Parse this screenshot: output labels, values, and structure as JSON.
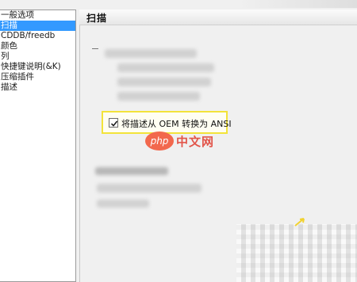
{
  "sidebar": {
    "items": [
      {
        "label": "一般选项",
        "selected": false
      },
      {
        "label": "扫描",
        "selected": true
      },
      {
        "label": "CDDB/freedb",
        "selected": false
      },
      {
        "label": "颜色",
        "selected": false
      },
      {
        "label": "列",
        "selected": false
      },
      {
        "label": "快捷键说明(&K)",
        "selected": false
      },
      {
        "label": "压缩插件",
        "selected": false
      },
      {
        "label": "描述",
        "selected": false
      }
    ]
  },
  "panel": {
    "title": "扫描",
    "oem_option": {
      "label": "将描述从 OEM 转换为 ANSI",
      "checked": true
    }
  },
  "watermark": {
    "badge": "php",
    "text": "中文网"
  },
  "colors": {
    "selection": "#3399ff",
    "highlight_border": "#f3e33a",
    "watermark": "#e2554a"
  }
}
